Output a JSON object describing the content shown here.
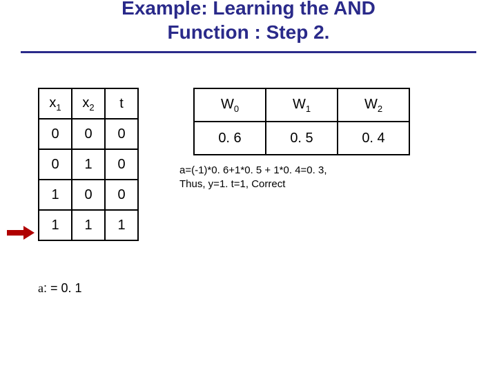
{
  "title_line1": "Example: Learning the AND",
  "title_line2": "Function : Step 2.",
  "and_table": {
    "headers": {
      "x1_base": "x",
      "x1_sub": "1",
      "x2_base": "x",
      "x2_sub": "2",
      "t": "t"
    },
    "rows": [
      {
        "x1": "0",
        "x2": "0",
        "t": "0"
      },
      {
        "x1": "0",
        "x2": "1",
        "t": "0"
      },
      {
        "x1": "1",
        "x2": "0",
        "t": "0"
      },
      {
        "x1": "1",
        "x2": "1",
        "t": "1"
      }
    ],
    "active_row_index": 3
  },
  "w_table": {
    "headers": {
      "w0_base": "W",
      "w0_sub": "0",
      "w1_base": "W",
      "w1_sub": "1",
      "w2_base": "W",
      "w2_sub": "2"
    },
    "values": {
      "w0": "0. 6",
      "w1": "0. 5",
      "w2": "0. 4"
    }
  },
  "calc": {
    "line1": "a=(-1)*0. 6+1*0. 5 + 1*0. 4=0. 3,",
    "line2": "Thus, y=1.  t=1, Correct"
  },
  "alpha": {
    "symbol": "a",
    "rest": ": = 0. 1"
  },
  "colors": {
    "accent": "#2a2a8a",
    "arrow": "#b00000"
  }
}
